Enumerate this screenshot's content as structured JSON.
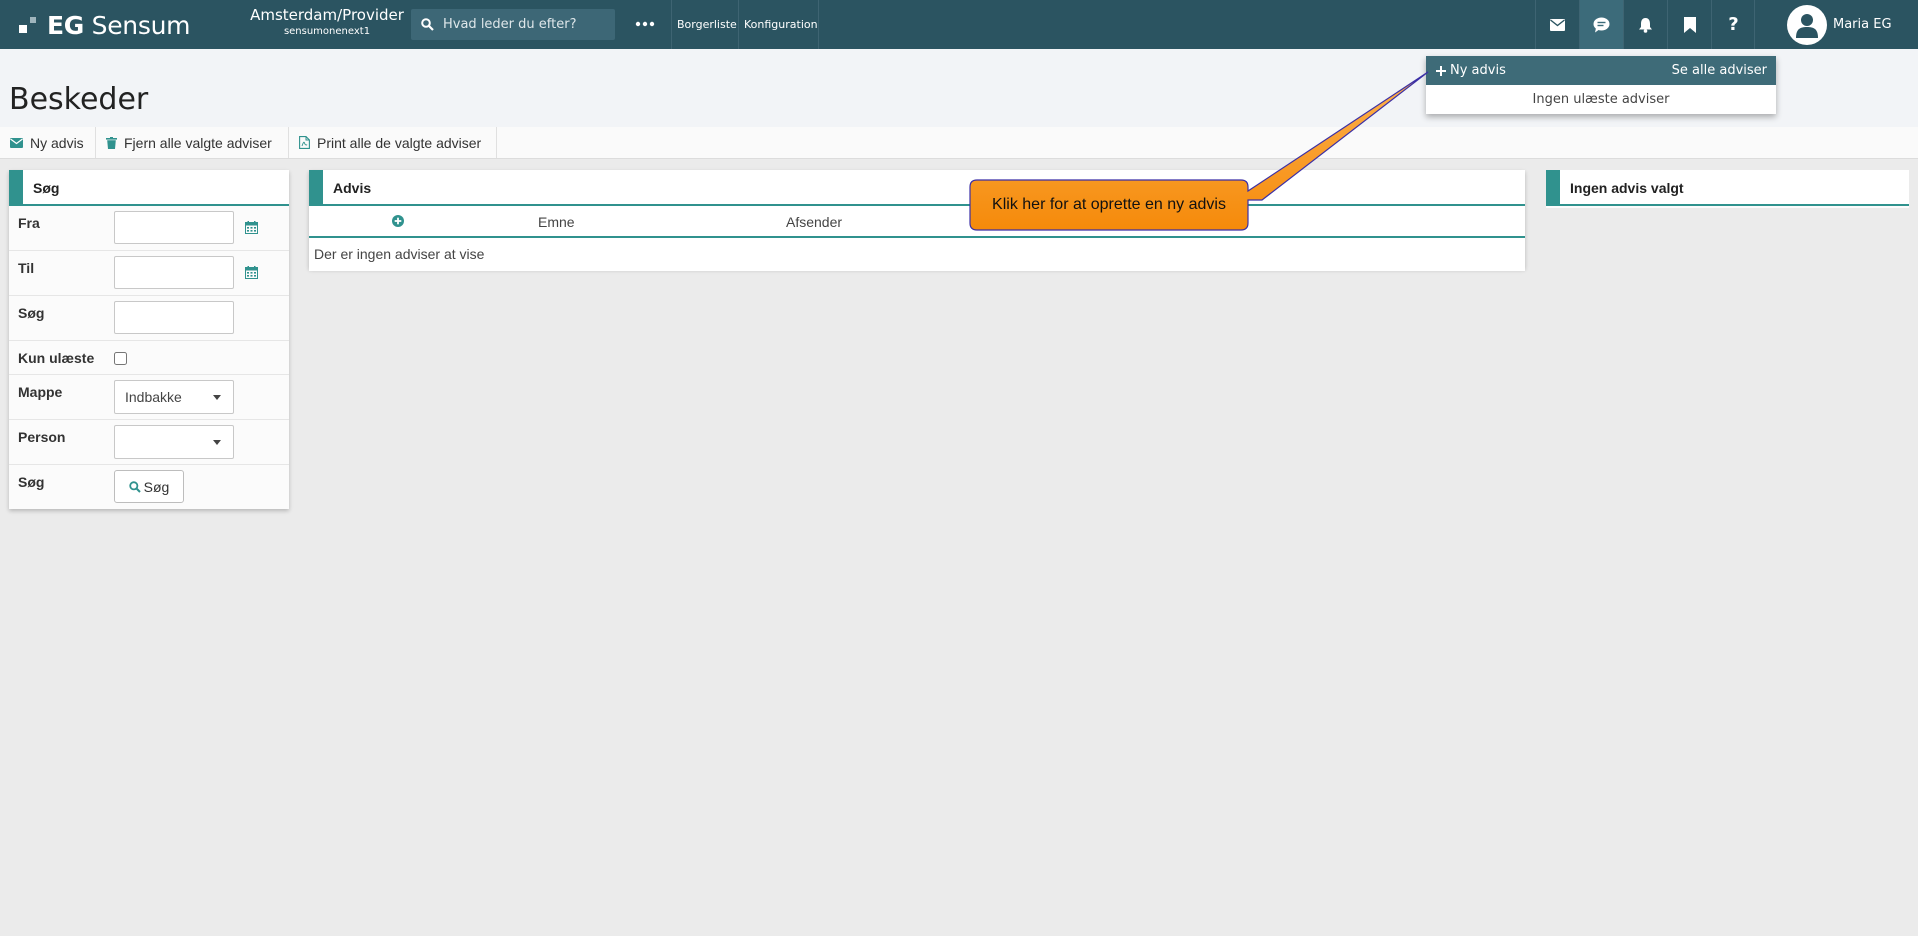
{
  "header": {
    "logo_eg": "EG",
    "logo_name": "Sensum",
    "org_name": "Amsterdam/Provider",
    "org_sub": "sensumonenext1",
    "search_placeholder": "Hvad leder du efter?",
    "nav": [
      "Borgerliste",
      "Konfiguration"
    ],
    "user_name": "Maria EG",
    "bar_color": "#2b5461"
  },
  "page": {
    "title": "Beskeder"
  },
  "toolbar": {
    "new": "Ny advis",
    "remove": "Fjern alle valgte adviser",
    "print": "Print alle de valgte adviser"
  },
  "search_panel": {
    "title": "Søg",
    "fields": {
      "from": "Fra",
      "to": "Til",
      "search": "Søg",
      "unread": "Kun ulæste",
      "folder": "Mappe",
      "person": "Person",
      "action": "Søg"
    },
    "folder_value": "Indbakke",
    "person_value": "",
    "button": "Søg"
  },
  "advis_panel": {
    "title": "Advis",
    "columns": [
      "Emne",
      "Afsender"
    ],
    "empty": "Der er ingen adviser at vise"
  },
  "detail_panel": {
    "title": "Ingen advis valgt"
  },
  "dropdown": {
    "new": "Ny advis",
    "see_all": "Se alle adviser",
    "empty": "Ingen ulæste adviser"
  },
  "callout": {
    "text": "Klik her for at oprette en ny advis",
    "color": "#f7941d"
  },
  "accent_color": "#30928e"
}
